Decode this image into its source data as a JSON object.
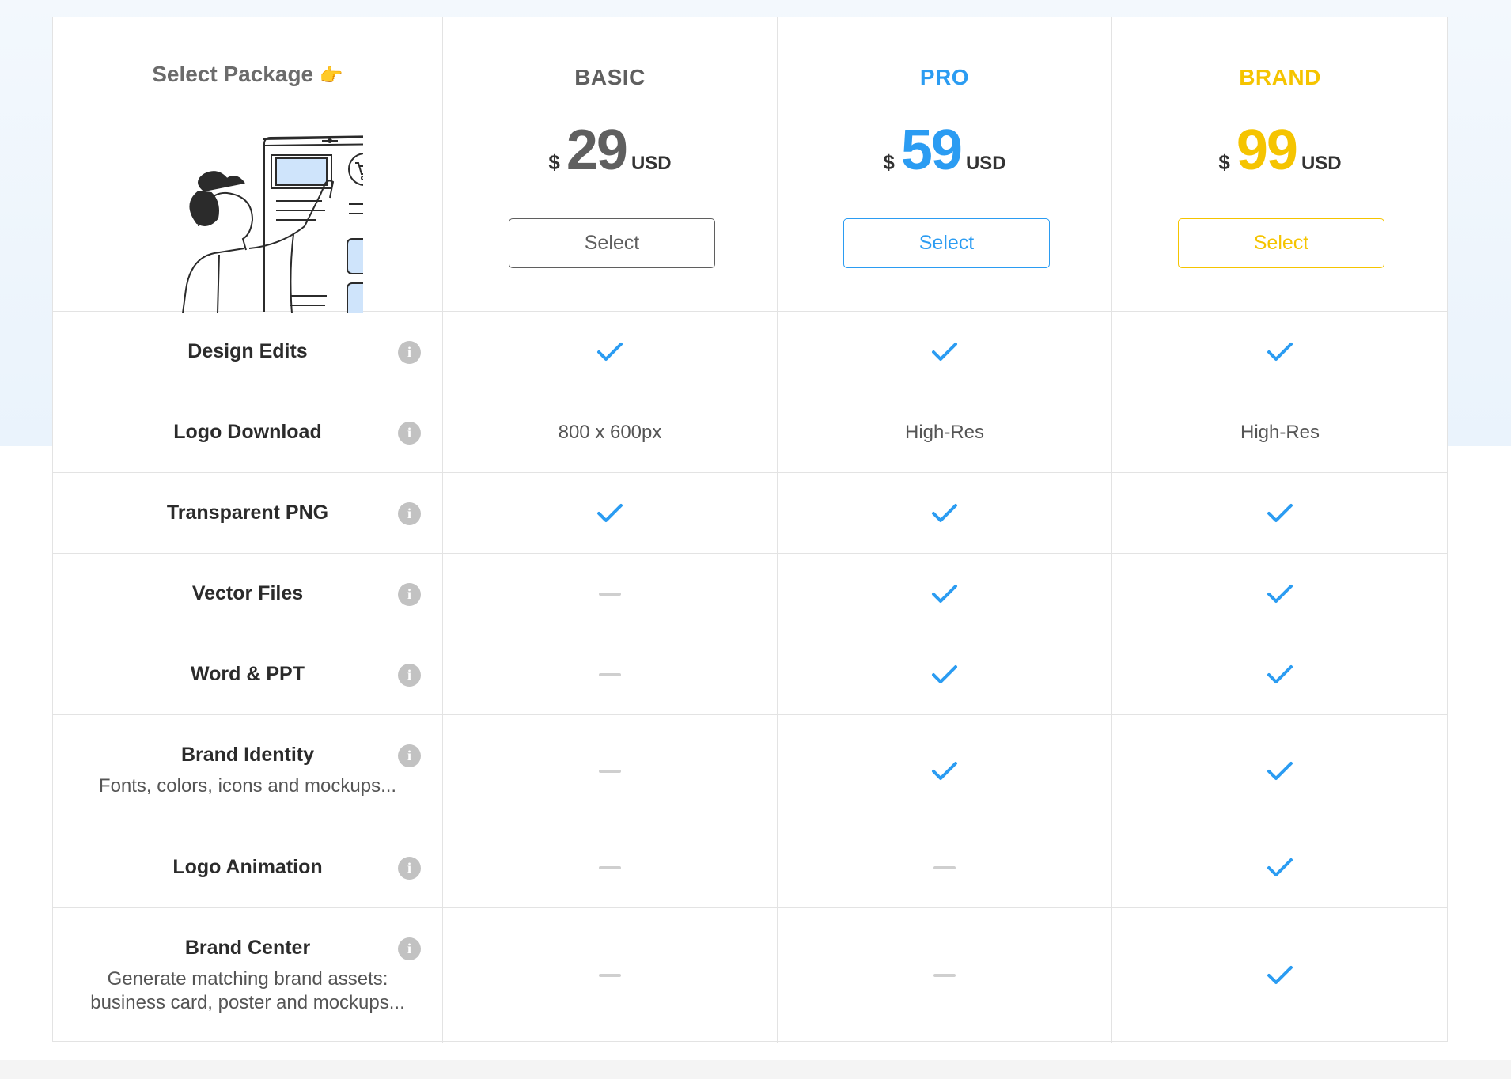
{
  "colors": {
    "basic": "#5f5f5f",
    "pro": "#2b9cf2",
    "brand": "#f5c400",
    "check": "#2b9cf2",
    "dash": "#cfcfcf"
  },
  "header": {
    "title": "Select Package",
    "hand": "👉"
  },
  "plans": [
    {
      "name": "BASIC",
      "currency": "$",
      "price": "29",
      "unit": "USD",
      "button": "Select"
    },
    {
      "name": "PRO",
      "currency": "$",
      "price": "59",
      "unit": "USD",
      "button": "Select"
    },
    {
      "name": "BRAND",
      "currency": "$",
      "price": "99",
      "unit": "USD",
      "button": "Select"
    }
  ],
  "features": [
    {
      "title": "Design Edits",
      "desc": "",
      "values": [
        "check",
        "check",
        "check"
      ]
    },
    {
      "title": "Logo Download",
      "desc": "",
      "values": [
        "800 x 600px",
        "High-Res",
        "High-Res"
      ]
    },
    {
      "title": "Transparent PNG",
      "desc": "",
      "values": [
        "check",
        "check",
        "check"
      ]
    },
    {
      "title": "Vector Files",
      "desc": "",
      "values": [
        "dash",
        "check",
        "check"
      ]
    },
    {
      "title": "Word & PPT",
      "desc": "",
      "values": [
        "dash",
        "check",
        "check"
      ]
    },
    {
      "title": "Brand Identity",
      "desc": "Fonts, colors, icons and mockups...",
      "values": [
        "dash",
        "check",
        "check"
      ]
    },
    {
      "title": "Logo Animation",
      "desc": "",
      "values": [
        "dash",
        "dash",
        "check"
      ]
    },
    {
      "title": "Brand Center",
      "desc": "Generate matching brand assets: business card, poster and mockups...",
      "values": [
        "dash",
        "dash",
        "check"
      ]
    }
  ]
}
